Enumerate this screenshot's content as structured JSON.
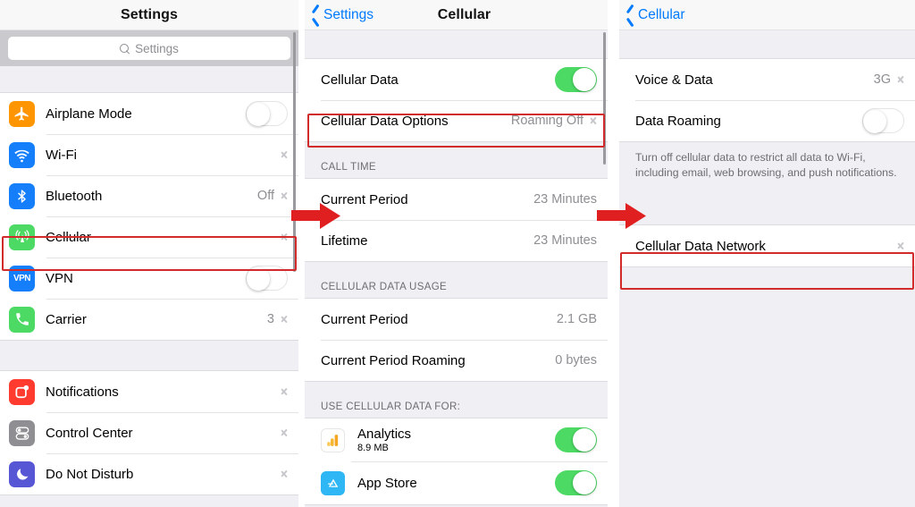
{
  "panels": {
    "settings": {
      "nav": {
        "title": "Settings"
      },
      "search": {
        "placeholder": "Settings",
        "icon": "search-icon"
      },
      "groups": [
        {
          "rows": [
            {
              "icon": "airplane-icon",
              "label": "Airplane Mode",
              "control": "toggle-off"
            },
            {
              "icon": "wifi-icon",
              "label": "Wi-Fi",
              "control": "chevron"
            },
            {
              "icon": "bluetooth-icon",
              "label": "Bluetooth",
              "value": "Off",
              "control": "chevron"
            },
            {
              "icon": "cellular-icon",
              "label": "Cellular",
              "control": "chevron",
              "highlight": true
            },
            {
              "icon": "vpn-icon",
              "label": "VPN",
              "control": "toggle-off"
            },
            {
              "icon": "carrier-icon",
              "label": "Carrier",
              "value": "3",
              "control": "chevron"
            }
          ]
        },
        {
          "rows": [
            {
              "icon": "notifications-icon",
              "label": "Notifications",
              "control": "chevron"
            },
            {
              "icon": "control-center-icon",
              "label": "Control Center",
              "control": "chevron"
            },
            {
              "icon": "do-not-disturb-icon",
              "label": "Do Not Disturb",
              "control": "chevron"
            }
          ]
        }
      ]
    },
    "cellular": {
      "nav": {
        "back_label": "Settings",
        "title": "Cellular"
      },
      "group1": [
        {
          "label": "Cellular Data",
          "control": "toggle-on"
        },
        {
          "label": "Cellular Data Options",
          "value": "Roaming Off",
          "control": "chevron",
          "highlight": true
        }
      ],
      "call_time": {
        "header": "CALL TIME",
        "rows": [
          {
            "label": "Current Period",
            "value": "23 Minutes"
          },
          {
            "label": "Lifetime",
            "value": "23 Minutes"
          }
        ]
      },
      "data_usage": {
        "header": "CELLULAR DATA USAGE",
        "rows": [
          {
            "label": "Current Period",
            "value": "2.1 GB"
          },
          {
            "label": "Current Period Roaming",
            "value": "0 bytes"
          }
        ]
      },
      "use_for": {
        "header": "USE CELLULAR DATA FOR:",
        "rows": [
          {
            "icon": "analytics-icon",
            "name": "Analytics",
            "size": "8.9 MB",
            "control": "toggle-on"
          },
          {
            "icon": "app-store-icon",
            "name": "App Store",
            "size": "",
            "control": "toggle-on"
          }
        ]
      }
    },
    "options": {
      "nav": {
        "back_label": "Cellular"
      },
      "rows": [
        {
          "label": "Voice & Data",
          "value": "3G",
          "control": "chevron"
        },
        {
          "label": "Data Roaming",
          "control": "toggle-off"
        }
      ],
      "footer": "Turn off cellular data to restrict all data to Wi-Fi, including email, web browsing, and push notifications.",
      "network_row": {
        "label": "Cellular Data Network",
        "control": "chevron",
        "highlight": true
      }
    }
  },
  "annotations": {
    "highlight_color": "#d12b2b",
    "arrow_color": "#e02020",
    "arrow1": "arrow-settings-to-cellular",
    "arrow2": "arrow-cellular-to-options"
  },
  "colors": {
    "accent_blue": "#007aff",
    "toggle_on_green": "#4cd964",
    "group_bg": "#efeff4",
    "secondary_text": "#8e8e93"
  }
}
